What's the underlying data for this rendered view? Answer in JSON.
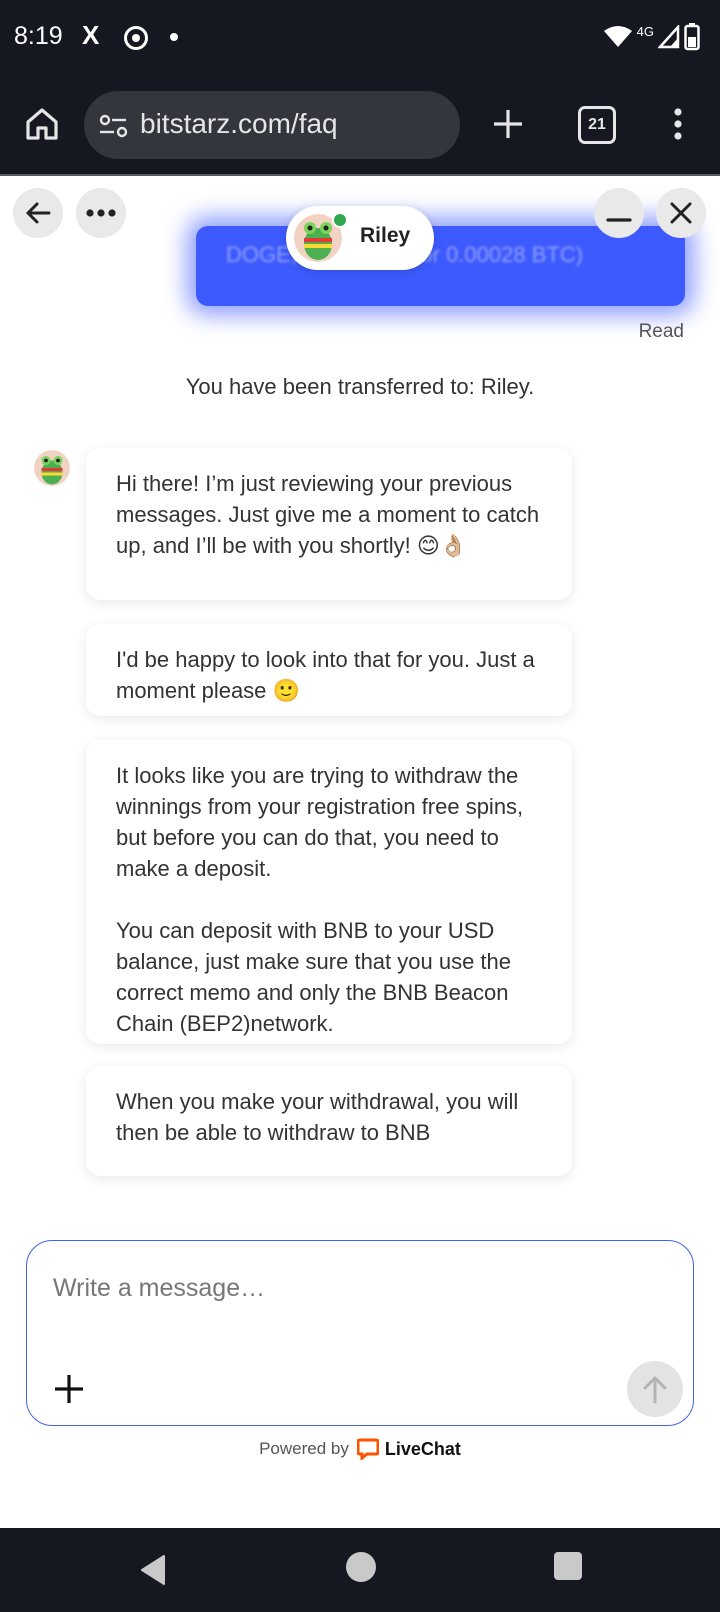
{
  "status_bar": {
    "time": "8:19",
    "x_icon": "X",
    "network": "4G"
  },
  "browser": {
    "url": "bitstarz.com/faq",
    "tab_count": "21"
  },
  "chat": {
    "agent_name": "Riley",
    "user_message_partial": "DOGE, 0.009 ETH, or 0.00028 BTC)",
    "read_label": "Read",
    "transfer_note": "You have been transferred to: Riley.",
    "messages": [
      {
        "text": "Hi there! I’m just reviewing your previous messages. Just give me a moment to catch up, and I’ll be with you shortly! 😊👌🏼"
      },
      {
        "text": "I'd be happy to look into that for you. Just a moment please 🙂"
      },
      {
        "text": "It looks like you are trying to withdraw the winnings from your registration free spins, but before you can do that, you need to make a deposit.\n\nYou can deposit with BNB to your USD balance, just make sure that you use the correct memo and only the BNB Beacon Chain (BEP2)network."
      },
      {
        "text": "When you make your withdrawal, you will then be able to withdraw to BNB"
      }
    ],
    "composer_placeholder": "Write a message…",
    "powered_by": "Powered by",
    "brand": "LiveChat"
  },
  "colors": {
    "accent": "#3d5afe",
    "composer_border": "#4262e8",
    "livechat_orange": "#ff5100",
    "online_green": "#2fa84f"
  }
}
